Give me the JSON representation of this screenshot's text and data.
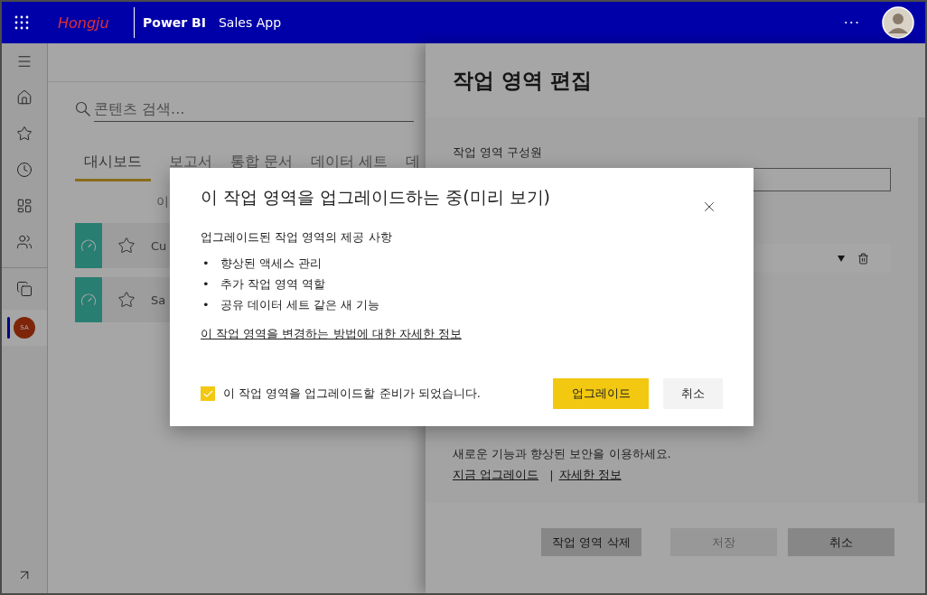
{
  "header": {
    "brand_logo": "Hongju",
    "product": "Power BI",
    "app_name": "Sales App",
    "more": "···"
  },
  "rail": {
    "items": [
      {
        "kind": "menu",
        "selected": false
      },
      {
        "kind": "home",
        "selected": false
      },
      {
        "kind": "favorites",
        "selected": false
      },
      {
        "kind": "recent",
        "selected": false
      },
      {
        "kind": "apps",
        "selected": false
      },
      {
        "kind": "shared",
        "selected": false
      },
      {
        "kind": "workspaces",
        "selected": false
      },
      {
        "kind": "workspace",
        "initials": "SA",
        "selected": true
      }
    ],
    "footer": {
      "kind": "expand"
    }
  },
  "main": {
    "search": {
      "placeholder": "콘텐츠 검색..."
    },
    "tabs": [
      {
        "label": "대시보드",
        "selected": true
      },
      {
        "label": "보고서",
        "selected": false
      },
      {
        "label": "통합 문서",
        "selected": false
      },
      {
        "label": "데이터 세트",
        "selected": false
      },
      {
        "label": "데",
        "selected": false
      }
    ],
    "columns": [
      "이"
    ],
    "rows": [
      {
        "name": "Cu",
        "favorite": false
      },
      {
        "name": "Sa",
        "favorite": false
      }
    ]
  },
  "panel": {
    "title": "작업 영역 편집",
    "members_label": "작업 영역 구성원",
    "upgrade_text": "새로운 기능과 향상된 보안을 이용하세요.",
    "links": [
      "지금 업그레이드",
      "자세한 정보"
    ],
    "separator": "|",
    "buttons": [
      {
        "label": "작업 영역 삭제",
        "disabled": false
      },
      {
        "label": "저장",
        "disabled": true
      },
      {
        "label": "취소",
        "disabled": false
      }
    ]
  },
  "dialog": {
    "title": "이 작업 영역을 업그레이드하는 중(미리 보기)",
    "subtitle": "업그레이드된 작업 영역의 제공 사항",
    "bullet_marker": "•",
    "bullets": [
      "향상된 액세스 관리",
      "추가 작업 영역 역할",
      "공유 데이터 세트 같은 새 기능"
    ],
    "link": "이 작업 영역을 변경하는 방법에 대한 자세한 정보",
    "confirm": {
      "label": "이 작업 영역을 업그레이드할 준비가 되었습니다.",
      "checked": true
    },
    "buttons": [
      {
        "label": "업그레이드",
        "primary": true
      },
      {
        "label": "취소",
        "primary": false
      }
    ]
  }
}
